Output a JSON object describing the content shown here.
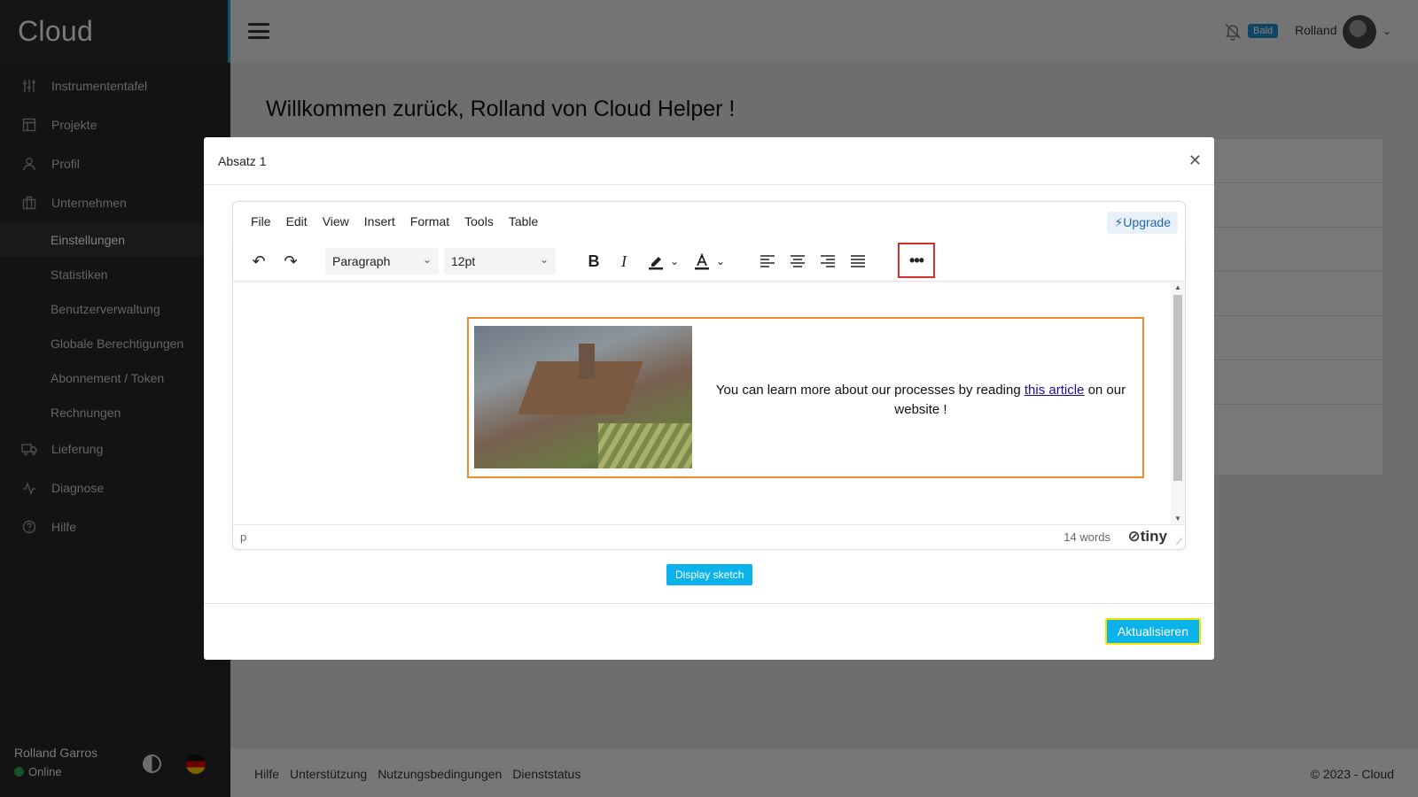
{
  "app": {
    "brand": "Cloud"
  },
  "sidebar": {
    "items": [
      {
        "label": "Instrumententafel",
        "icon": "sliders-icon"
      },
      {
        "label": "Projekte",
        "icon": "layout-icon"
      },
      {
        "label": "Profil",
        "icon": "user-icon"
      },
      {
        "label": "Unternehmen",
        "icon": "building-icon"
      }
    ],
    "subitems": [
      {
        "label": "Einstellungen",
        "active": true
      },
      {
        "label": "Statistiken"
      },
      {
        "label": "Benutzerverwaltung"
      },
      {
        "label": "Globale Berechtigungen"
      },
      {
        "label": "Abonnement / Token"
      },
      {
        "label": "Rechnungen"
      }
    ],
    "items2": [
      {
        "label": "Lieferung",
        "icon": "truck-icon"
      },
      {
        "label": "Diagnose",
        "icon": "activity-icon"
      },
      {
        "label": "Hilfe",
        "icon": "help-icon"
      }
    ],
    "user": {
      "name": "Rolland Garros",
      "status": "Online"
    }
  },
  "topbar": {
    "soon_badge": "Bald",
    "user": "Rolland"
  },
  "main": {
    "welcome": "Willkommen zurück, Rolland von Cloud Helper !"
  },
  "footer": {
    "links": [
      "Hilfe",
      "Unterstützung",
      "Nutzungsbedingungen",
      "Dienststatus"
    ],
    "copyright": "© 2023 - Cloud"
  },
  "modal": {
    "title": "Absatz 1",
    "editor": {
      "menu": [
        "File",
        "Edit",
        "View",
        "Insert",
        "Format",
        "Tools",
        "Table"
      ],
      "upgrade": "Upgrade",
      "block_format": "Paragraph",
      "font_size": "12pt",
      "content": {
        "text_before": "You can learn more about our processes by reading ",
        "link_text": "this article",
        "text_after": " on our website !"
      },
      "status_path": "p",
      "word_count": "14 words",
      "brand": "tiny"
    },
    "display_button": "Display sketch",
    "update_button": "Aktualisieren"
  },
  "colors": {
    "accent": "#0bb3ea",
    "sidebar": "#262626",
    "highlight_red": "#d32f2f",
    "highlight_orange": "#ef8b2c",
    "highlight_yellow": "#f5e600"
  }
}
